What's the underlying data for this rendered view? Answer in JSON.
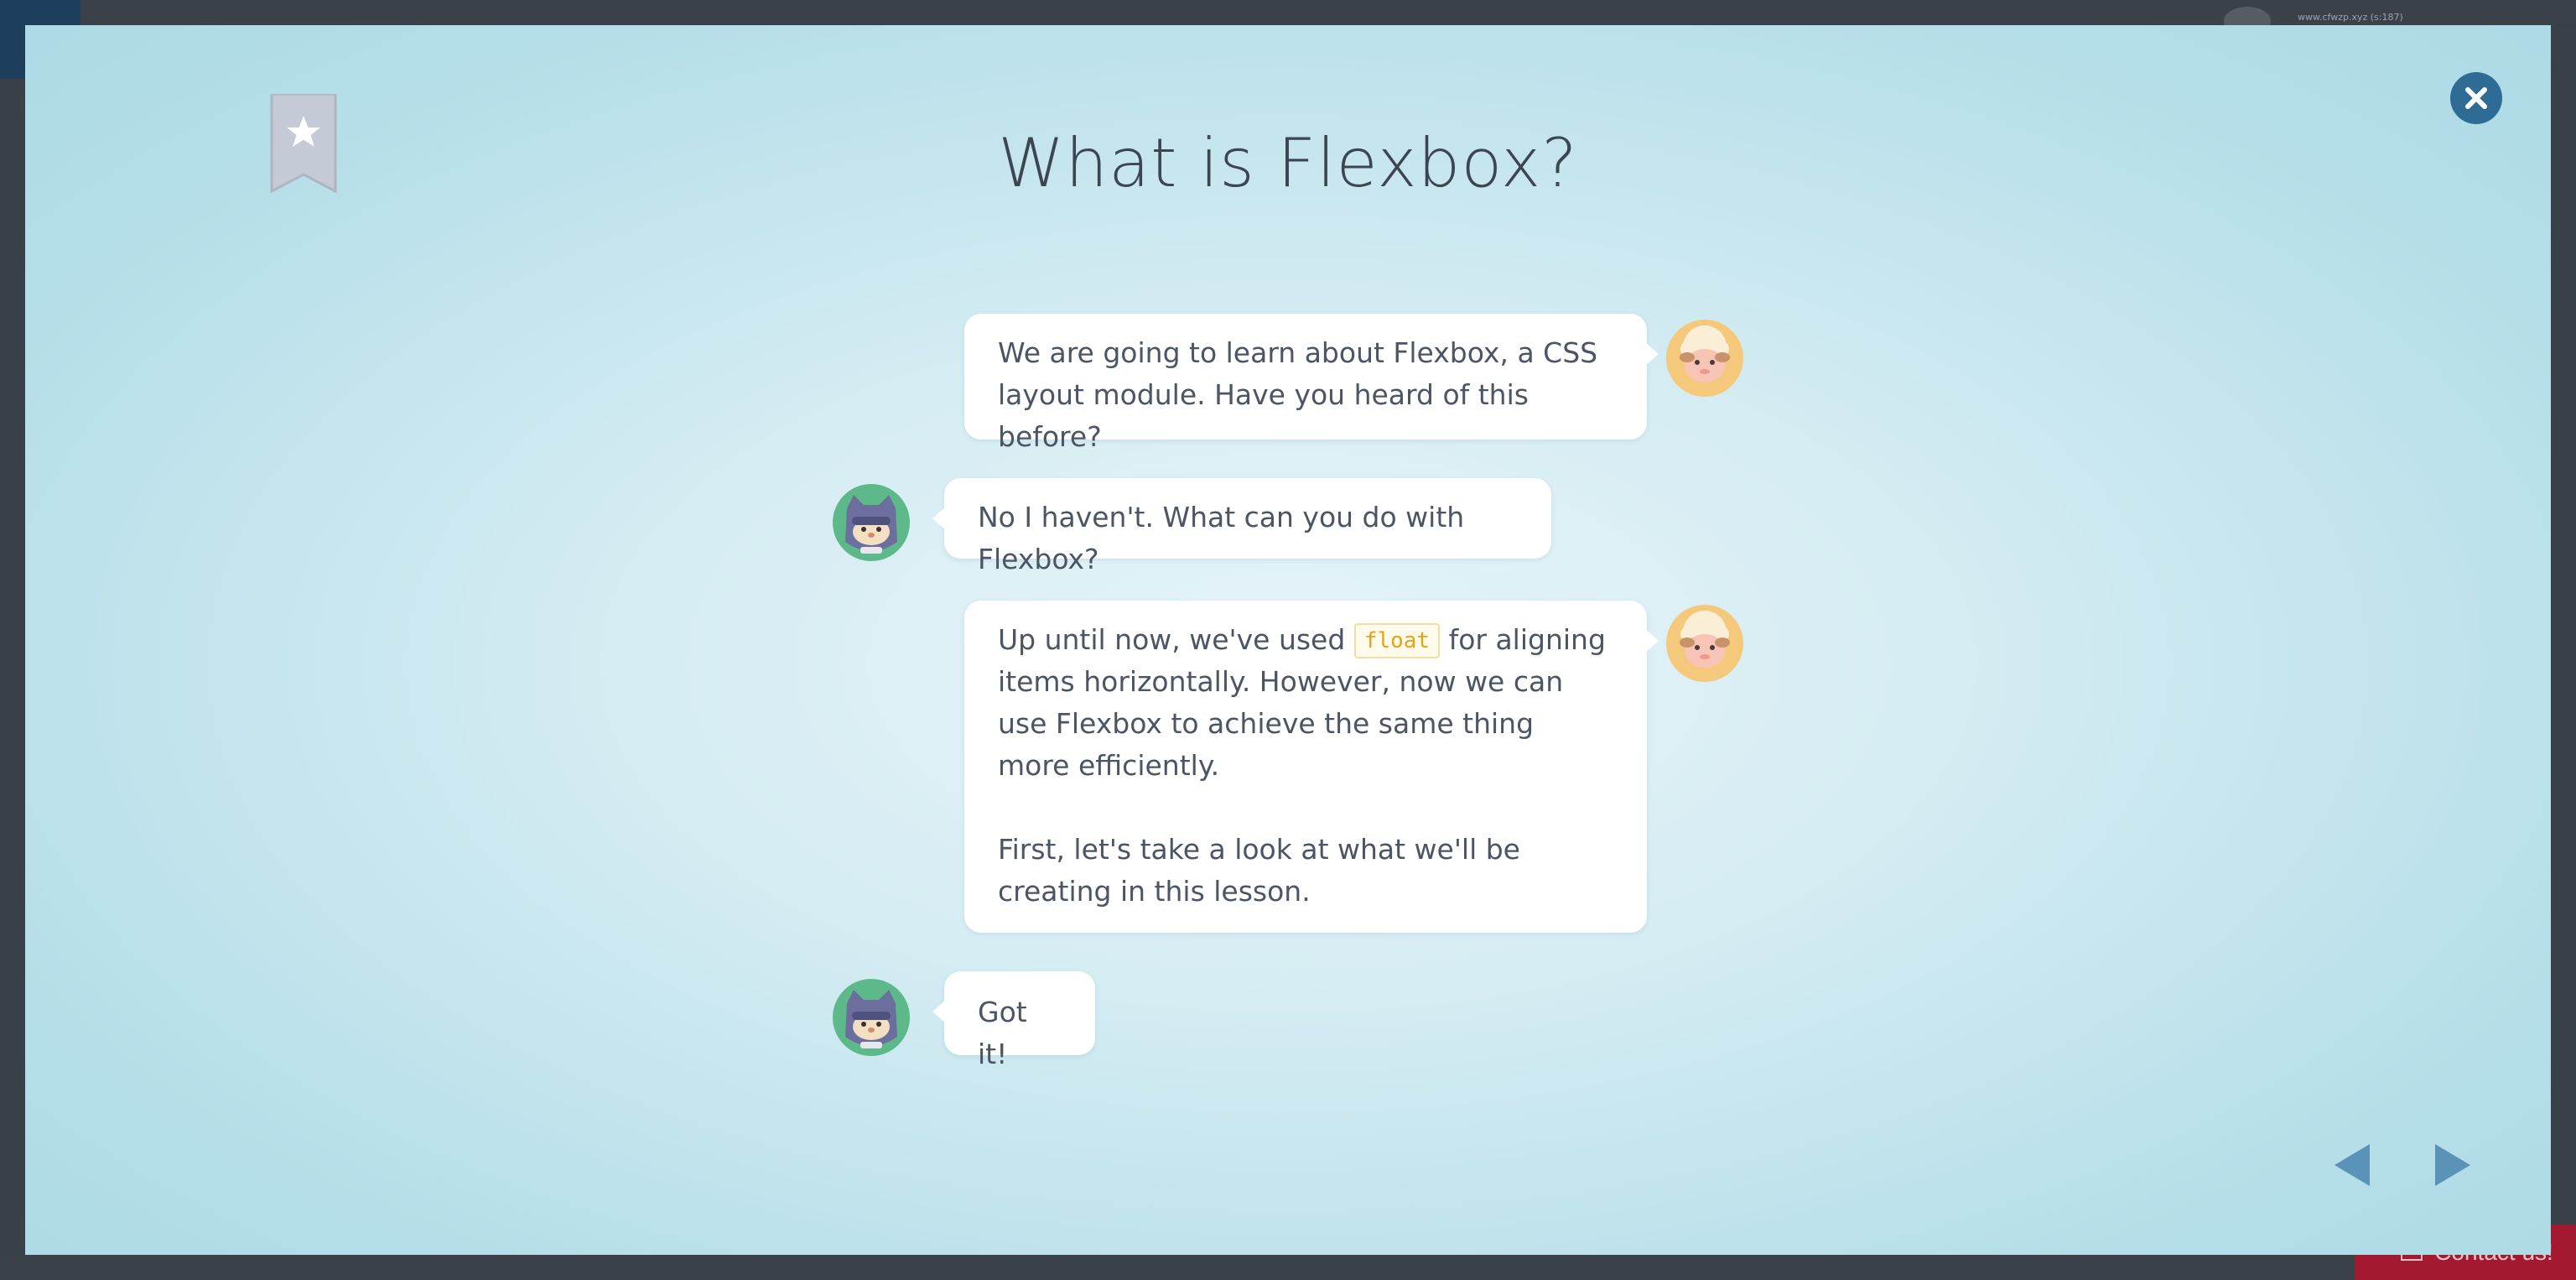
{
  "background": {
    "url_text": "www.cfwzp.xyz (s:187)",
    "contact_label": "Contact us!"
  },
  "modal": {
    "title": "What is Flexbox?",
    "bookmark_icon": "bookmark-star-icon",
    "close_icon": "close-icon",
    "colors": {
      "bubble": "#ffffff",
      "text": "#4b5563",
      "title": "#3d4650",
      "accent": "#2f6c95",
      "code": "#e8a21a"
    }
  },
  "messages": {
    "m1": {
      "text": "We are going to learn about Flexbox, a CSS layout module. Have you heard of this before?"
    },
    "m2": {
      "text": "No I haven't. What can you do with Flexbox?"
    },
    "m3": {
      "before_code": "Up until now, we've used",
      "code": "float",
      "after_code": "for aligning items horizontally. However, now we can use Flexbox to achieve the same thing more efficiently.",
      "paragraph2": "First, let's take a look at what we'll be creating in this lesson."
    },
    "m4": {
      "text": "Got it!"
    }
  },
  "avatars": {
    "teacher": "sheep-avatar-icon",
    "student": "ninja-cat-avatar-icon"
  },
  "navigation": {
    "prev_icon": "triangle-left-icon",
    "next_icon": "triangle-right-icon"
  }
}
